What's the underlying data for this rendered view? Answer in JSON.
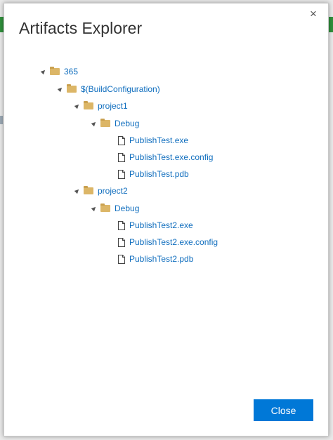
{
  "dialog": {
    "title": "Artifacts Explorer",
    "close_glyph": "×",
    "close_button_label": "Close",
    "accent_color": "#0078d7",
    "link_color": "#106ebe"
  },
  "tree": [
    {
      "label": "365",
      "type": "folder",
      "expanded": true,
      "level": 0
    },
    {
      "label": "$(BuildConfiguration)",
      "type": "folder",
      "expanded": true,
      "level": 1
    },
    {
      "label": "project1",
      "type": "folder",
      "expanded": true,
      "level": 2
    },
    {
      "label": "Debug",
      "type": "folder",
      "expanded": true,
      "level": 3
    },
    {
      "label": "PublishTest.exe",
      "type": "file",
      "level": 4
    },
    {
      "label": "PublishTest.exe.config",
      "type": "file",
      "level": 4
    },
    {
      "label": "PublishTest.pdb",
      "type": "file",
      "level": 4
    },
    {
      "label": "project2",
      "type": "folder",
      "expanded": true,
      "level": 2
    },
    {
      "label": "Debug",
      "type": "folder",
      "expanded": true,
      "level": 3
    },
    {
      "label": "PublishTest2.exe",
      "type": "file",
      "level": 4
    },
    {
      "label": "PublishTest2.exe.config",
      "type": "file",
      "level": 4
    },
    {
      "label": "PublishTest2.pdb",
      "type": "file",
      "level": 4
    }
  ]
}
